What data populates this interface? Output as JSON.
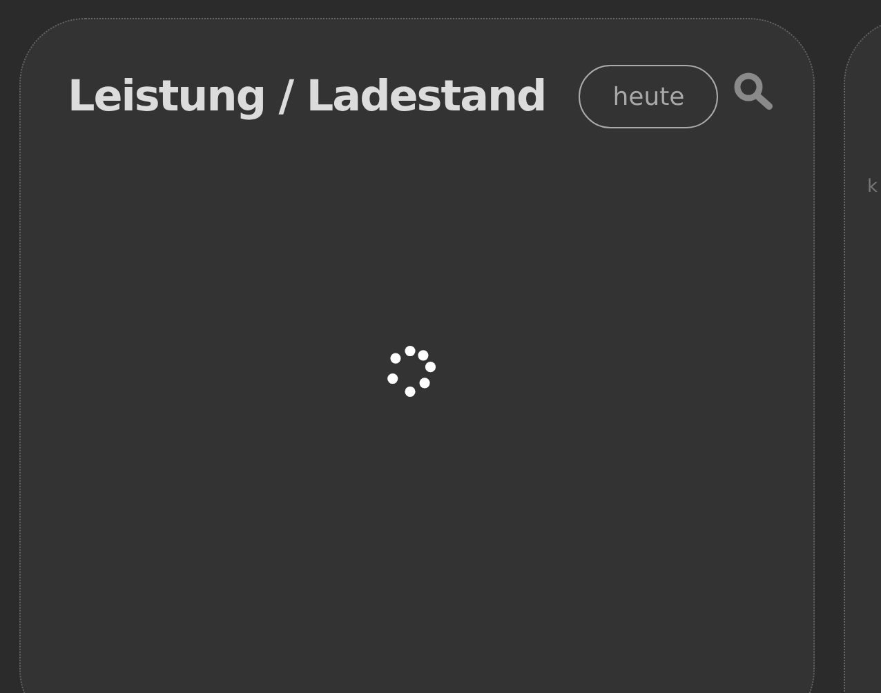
{
  "card": {
    "title": "Leistung / Ladestand",
    "period_button": "heute",
    "loading": true
  },
  "next_card": {
    "unit_label": "k"
  }
}
